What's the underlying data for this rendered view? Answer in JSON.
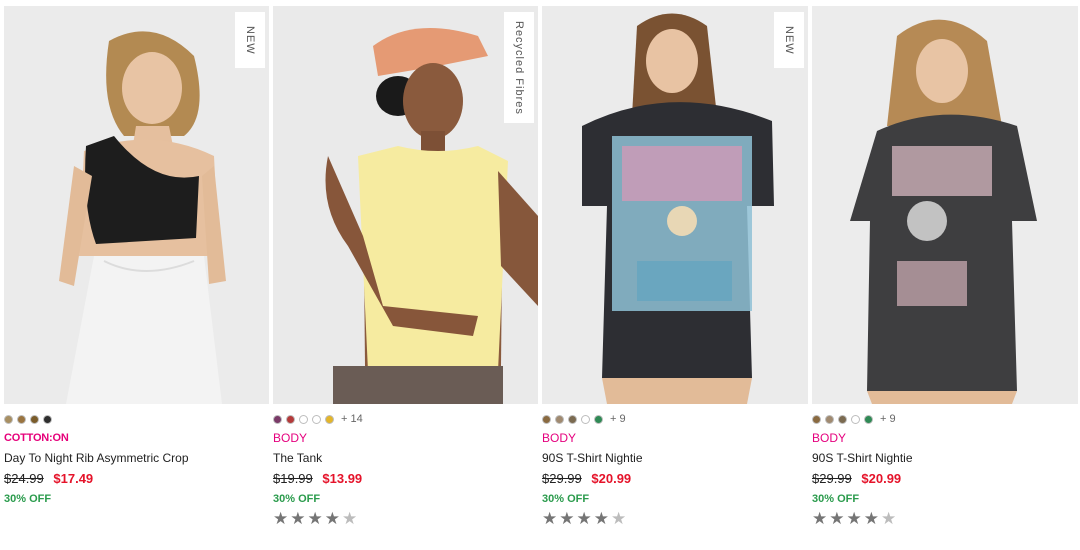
{
  "products": [
    {
      "badge": "NEW",
      "swatches": [
        "#a88f62",
        "#9a7440",
        "#7a5c2a",
        "#2e2e2e"
      ],
      "more_colors": "",
      "brand": "COTTON:ON",
      "name": "Day To Night Rib Asymmetric Crop",
      "was_price": "$24.99",
      "now_price": "$17.49",
      "discount": "30% OFF",
      "rating": null
    },
    {
      "badge": "Recycled Fibres",
      "swatches": [
        "#7a3a68",
        "#b43a3a",
        "#ffffff",
        "#ffffff",
        "#e3b52a"
      ],
      "more_colors": "+ 14",
      "brand": "BODY",
      "name": "The Tank",
      "was_price": "$19.99",
      "now_price": "$13.99",
      "discount": "30% OFF",
      "rating": 4.5
    },
    {
      "badge": "NEW",
      "swatches": [
        "#8a6a40",
        "#a08a70",
        "#7b6a50",
        "#ffffff",
        "#2f8a55"
      ],
      "more_colors": "+ 9",
      "brand": "BODY",
      "name": "90S T-Shirt Nightie",
      "was_price": "$29.99",
      "now_price": "$20.99",
      "discount": "30% OFF",
      "rating": 4.5
    },
    {
      "badge": "",
      "swatches": [
        "#8a6a40",
        "#a08a70",
        "#7b6a50",
        "#ffffff",
        "#2f8a55"
      ],
      "more_colors": "+ 9",
      "brand": "BODY",
      "name": "90S T-Shirt Nightie",
      "was_price": "$29.99",
      "now_price": "$20.99",
      "discount": "30% OFF",
      "rating": 4.5
    }
  ],
  "icons": {
    "star": "star-icon",
    "star_half": "half-star-icon"
  }
}
